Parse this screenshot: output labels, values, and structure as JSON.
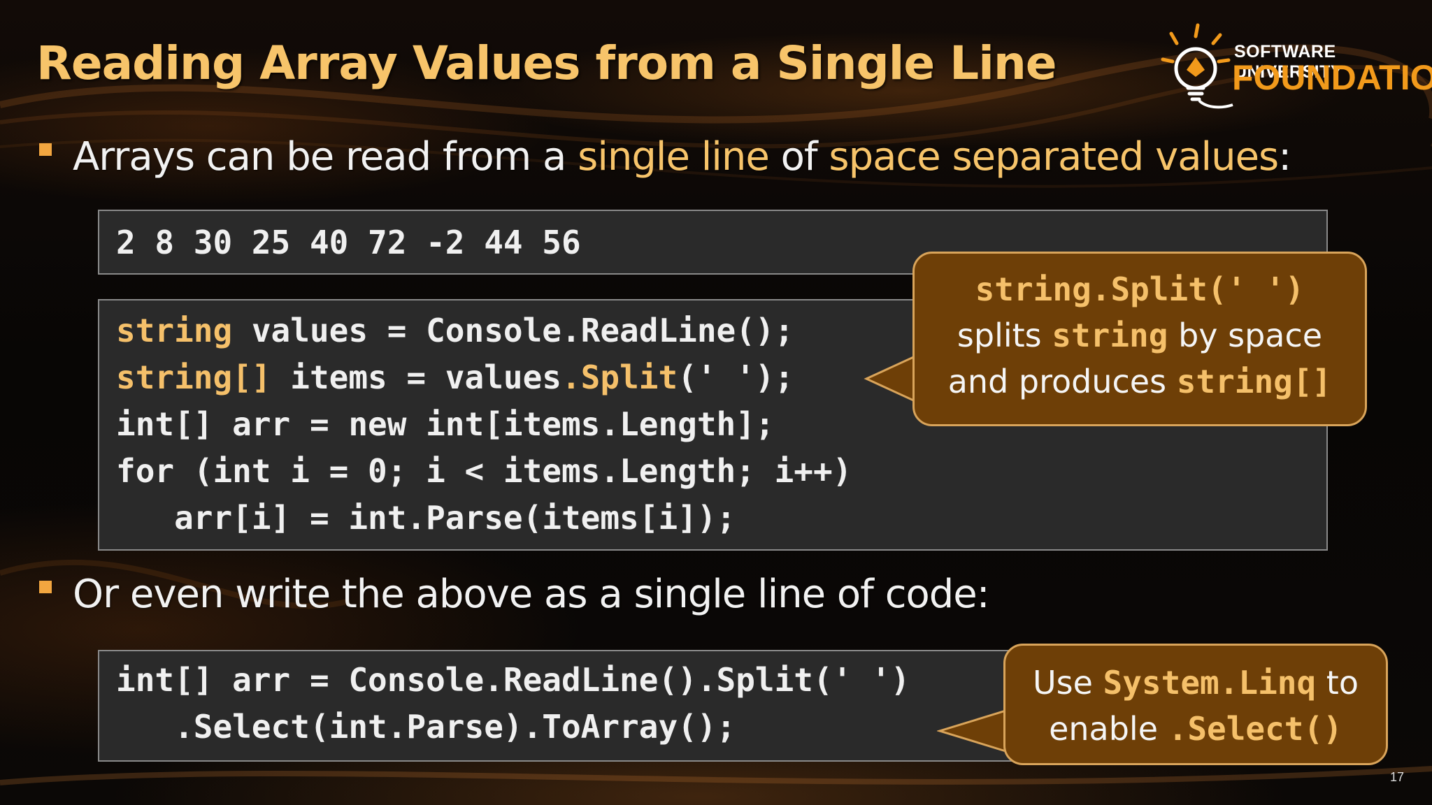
{
  "slide": {
    "title": "Reading Array Values from a Single Line",
    "page_number": "17"
  },
  "logo": {
    "top_text": "SOFTWARE UNIVERSITY",
    "bottom_text": "FOUNDATION",
    "icon": "lightbulb-icon"
  },
  "bullet1": {
    "part1": "Arrays can be read from a ",
    "highlight1": "single line",
    "part2": " of ",
    "highlight2": "space separated values",
    "part3": ":"
  },
  "input_example": "2 8 30 25 40 72 -2 44 56",
  "code1": {
    "line1_kw": "string",
    "line1_rest": " values = Console.ReadLine();",
    "line2_kw": "string[]",
    "line2_mid": " items = values",
    "line2_kw2": ".Split",
    "line2_rest": "(' ');",
    "line3": "int[] arr = new int[items.Length];",
    "line4": "for (int i = 0; i < items.Length; i++)",
    "line5": "   arr[i] = int.Parse(items[i]);"
  },
  "callout1": {
    "code": "string.Split(' ')",
    "text_a": "splits ",
    "code_b": "string",
    "text_c": " by space",
    "text_d": "and produces ",
    "code_e": "string[]"
  },
  "bullet2": {
    "text": "Or even write the above as a single line of code:"
  },
  "code2": {
    "line1": "int[] arr = Console.ReadLine().Split(' ')",
    "line2": "   .Select(int.Parse).ToArray();"
  },
  "callout2": {
    "text_a": "Use ",
    "code_b": "System.Linq",
    "text_c": " to",
    "text_d": "enable ",
    "code_e": ".Select()"
  },
  "colors": {
    "title": "#f7c46a",
    "highlight": "#f7c46a",
    "bullet": "#f2a640",
    "callout_bg": "#6e3f07",
    "callout_border": "#d9a45a",
    "code_bg": "#2a2a2a",
    "logo_orange": "#f29a1b"
  }
}
